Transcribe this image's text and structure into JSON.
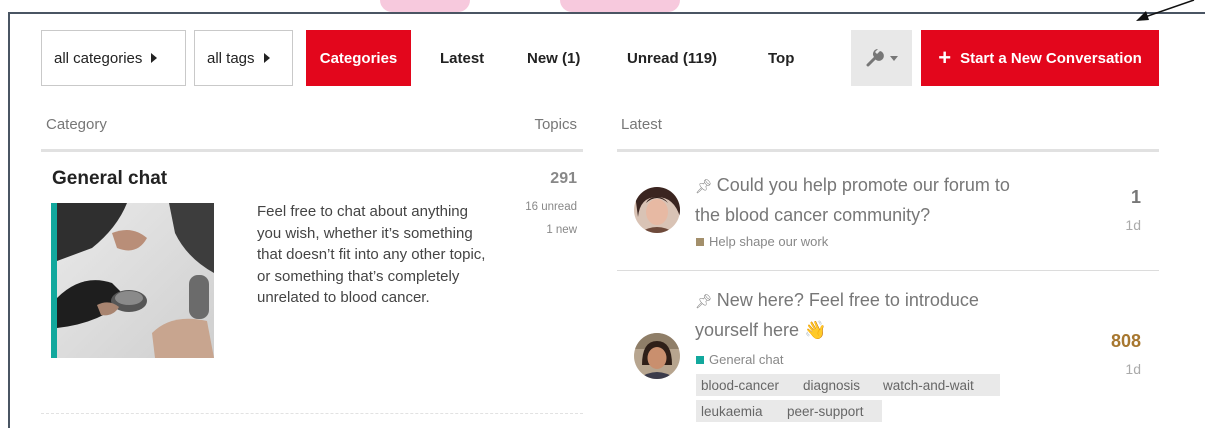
{
  "nav": {
    "all_categories": "all categories",
    "all_tags": "all tags",
    "categories": "Categories",
    "latest": "Latest",
    "new": "New (1)",
    "unread": "Unread (119)",
    "top": "Top",
    "new_conversation": "Start a New Conversation"
  },
  "colors": {
    "accent": "#e3061c",
    "category_teal": "#12a89d",
    "category_tan": "#a38f6b",
    "reply_hot": "#a7772f"
  },
  "headers": {
    "category": "Category",
    "topics": "Topics",
    "latest": "Latest"
  },
  "category": {
    "name": "General chat",
    "description": "Feel free to chat about anything you wish, whether it’s something that doesn’t fit into any other topic, or something that’s completely unrelated to blood cancer.",
    "topics": "291",
    "unread": "16 unread",
    "new": "1 new"
  },
  "latest": [
    {
      "title": "Could you help promote our forum to the blood cancer community?",
      "category": "Help shape our work",
      "replies": "1",
      "age": "1d"
    },
    {
      "title": "New here? Feel free to introduce yourself here 👋",
      "category": "General chat",
      "tags": [
        "blood-cancer",
        "diagnosis",
        "watch-and-wait",
        "leukaemia",
        "peer-support"
      ],
      "replies": "808",
      "age": "1d"
    }
  ]
}
